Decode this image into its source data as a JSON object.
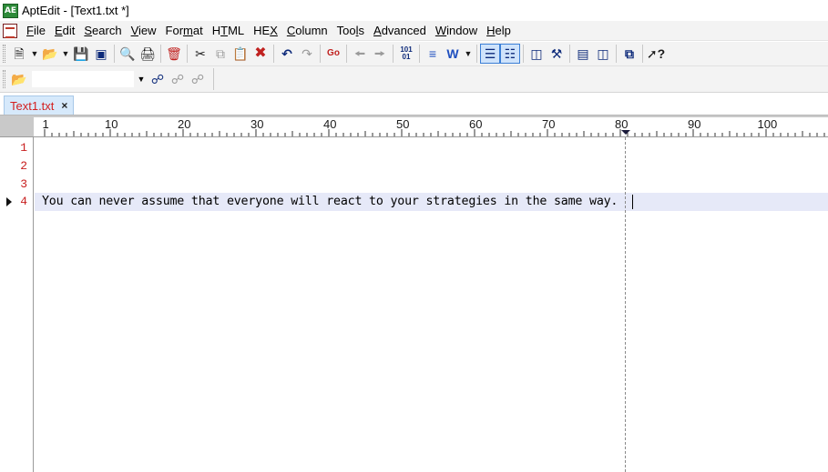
{
  "window": {
    "title": "AptEdit - [Text1.txt *]",
    "app_icon_text": "AE"
  },
  "menu": {
    "items": [
      {
        "pre": "",
        "u": "F",
        "post": "ile"
      },
      {
        "pre": "",
        "u": "E",
        "post": "dit"
      },
      {
        "pre": "",
        "u": "S",
        "post": "earch"
      },
      {
        "pre": "",
        "u": "V",
        "post": "iew"
      },
      {
        "pre": "For",
        "u": "m",
        "post": "at"
      },
      {
        "pre": "H",
        "u": "T",
        "post": "ML"
      },
      {
        "pre": "HE",
        "u": "X",
        "post": ""
      },
      {
        "pre": "",
        "u": "C",
        "post": "olumn"
      },
      {
        "pre": "Too",
        "u": "l",
        "post": "s"
      },
      {
        "pre": "",
        "u": "A",
        "post": "dvanced"
      },
      {
        "pre": "",
        "u": "W",
        "post": "indow"
      },
      {
        "pre": "",
        "u": "H",
        "post": "elp"
      }
    ]
  },
  "toolbar": {
    "icons": {
      "new": "new-file-icon",
      "open": "open-folder-icon",
      "save": "save-icon",
      "save_all": "save-all-icon",
      "print_preview": "print-preview-icon",
      "print": "print-icon",
      "close_file": "close-file-icon",
      "cut": "cut-icon",
      "copy": "copy-icon",
      "paste": "paste-icon",
      "delete": "delete-icon",
      "undo": "undo-icon",
      "redo": "redo-icon",
      "go_to": "go-to-icon",
      "prev": "previous-bookmark-icon",
      "next": "next-bookmark-icon",
      "hex": "hex-mode-icon",
      "format": "format-icon",
      "word_wrap": "word-wrap-icon",
      "line_numbers": "line-numbers-icon",
      "ruler": "ruler-icon",
      "panel": "panel-icon",
      "tools": "tools-icon",
      "window_a": "window-icon",
      "window_b": "split-window-icon",
      "export": "export-icon",
      "help": "context-help-icon"
    },
    "binary_label": "101\n01",
    "go_label": "Go"
  },
  "search_toolbar": {
    "search_value": "",
    "icons": {
      "open": "open-folder-icon",
      "find": "find-binoculars-icon",
      "find_prev": "find-previous-icon",
      "find_next": "find-next-icon"
    }
  },
  "tabs": [
    {
      "label": "Text1.txt",
      "close": "×"
    }
  ],
  "ruler": {
    "labels": [
      "1",
      "10",
      "20",
      "30",
      "40",
      "50",
      "60",
      "70",
      "80",
      "90",
      "100"
    ],
    "marker_column": 81
  },
  "editor": {
    "lines": [
      {
        "number": "1",
        "text": ""
      },
      {
        "number": "2",
        "text": ""
      },
      {
        "number": "3",
        "text": ""
      },
      {
        "number": "4",
        "text": "You can never assume that everyone will react to your strategies in the same way."
      }
    ],
    "current_line": 4,
    "colors": {
      "line_number": "#c81e1e",
      "current_line_bg": "#e6e9f8",
      "tab_text": "#d41f1f"
    }
  }
}
